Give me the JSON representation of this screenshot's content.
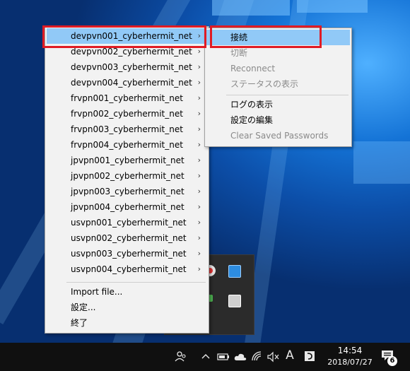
{
  "main_menu": {
    "items": [
      {
        "label": "devpvn001_cyberhermit_net",
        "submenu": true
      },
      {
        "label": "devpvn002_cyberhermit_net",
        "submenu": true
      },
      {
        "label": "devpvn003_cyberhermit_net",
        "submenu": true
      },
      {
        "label": "devpvn004_cyberhermit_net",
        "submenu": true
      },
      {
        "label": "frvpn001_cyberhermit_net",
        "submenu": true
      },
      {
        "label": "frvpn002_cyberhermit_net",
        "submenu": true
      },
      {
        "label": "frvpn003_cyberhermit_net",
        "submenu": true
      },
      {
        "label": "frvpn004_cyberhermit_net",
        "submenu": true
      },
      {
        "label": "jpvpn001_cyberhermit_net",
        "submenu": true
      },
      {
        "label": "jpvpn002_cyberhermit_net",
        "submenu": true
      },
      {
        "label": "jpvpn003_cyberhermit_net",
        "submenu": true
      },
      {
        "label": "jpvpn004_cyberhermit_net",
        "submenu": true
      },
      {
        "label": "usvpn001_cyberhermit_net",
        "submenu": true
      },
      {
        "label": "usvpn002_cyberhermit_net",
        "submenu": true
      },
      {
        "label": "usvpn003_cyberhermit_net",
        "submenu": true
      },
      {
        "label": "usvpn004_cyberhermit_net",
        "submenu": true
      }
    ],
    "import_file": "Import file...",
    "settings": "設定...",
    "exit": "終了",
    "arrow": "›"
  },
  "sub_menu": {
    "connect": "接続",
    "disconnect": "切断",
    "reconnect": "Reconnect",
    "show_status": "ステータスの表示",
    "show_log": "ログの表示",
    "edit_config": "設定の編集",
    "clear_saved_passwords": "Clear Saved Passwords"
  },
  "taskbar": {
    "time": "14:54",
    "date": "2018/07/27",
    "ime_indicator": "A",
    "notification_count": "6"
  },
  "colors": {
    "highlight": "#91c9f7",
    "annotation_red": "#e01b24",
    "menu_bg": "#f2f2f2"
  }
}
